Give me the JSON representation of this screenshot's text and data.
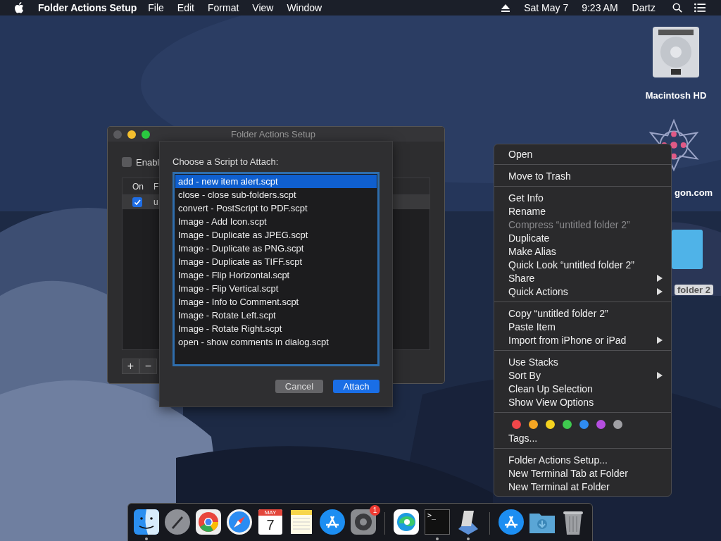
{
  "menubar": {
    "app_name": "Folder Actions Setup",
    "menus": [
      "File",
      "Edit",
      "Format",
      "View",
      "Window"
    ],
    "date": "Sat May 7",
    "time": "9:23 AM",
    "user": "Dartz"
  },
  "desktop_icons": [
    {
      "label": "Macintosh HD",
      "kind": "disk"
    },
    {
      "label": "gon.com",
      "kind": "star"
    },
    {
      "label": "folder 2",
      "kind": "folder"
    }
  ],
  "window": {
    "title": "Folder Actions Setup",
    "enable": {
      "label": "Enabl",
      "checked": false
    },
    "columns": [
      "On",
      "F"
    ],
    "rows": [
      {
        "on": true,
        "text": "u"
      }
    ],
    "add_label": "+",
    "remove_label": "−"
  },
  "sheet": {
    "prompt": "Choose a Script to Attach:",
    "scripts": [
      {
        "label": "add - new item alert.scpt",
        "selected": true
      },
      {
        "label": "close - close sub-folders.scpt",
        "selected": false
      },
      {
        "label": "convert - PostScript to PDF.scpt",
        "selected": false
      },
      {
        "label": "Image - Add Icon.scpt",
        "selected": false
      },
      {
        "label": "Image - Duplicate as JPEG.scpt",
        "selected": false
      },
      {
        "label": "Image - Duplicate as PNG.scpt",
        "selected": false
      },
      {
        "label": "Image - Duplicate as TIFF.scpt",
        "selected": false
      },
      {
        "label": "Image - Flip Horizontal.scpt",
        "selected": false
      },
      {
        "label": "Image - Flip Vertical.scpt",
        "selected": false
      },
      {
        "label": "Image - Info to Comment.scpt",
        "selected": false
      },
      {
        "label": "Image - Rotate Left.scpt",
        "selected": false
      },
      {
        "label": "Image - Rotate Right.scpt",
        "selected": false
      },
      {
        "label": "open - show comments in dialog.scpt",
        "selected": false
      }
    ],
    "cancel": "Cancel",
    "attach": "Attach"
  },
  "context_menu": [
    {
      "items": [
        {
          "label": "Open",
          "kind": "item",
          "disabled": false
        }
      ]
    },
    {
      "items": [
        {
          "label": "Move to Trash",
          "kind": "item",
          "disabled": false
        }
      ]
    },
    {
      "items": [
        {
          "label": "Get Info",
          "kind": "item",
          "disabled": false
        },
        {
          "label": "Rename",
          "kind": "item",
          "disabled": false
        },
        {
          "label": "Compress “untitled folder 2”",
          "kind": "item",
          "disabled": true
        },
        {
          "label": "Duplicate",
          "kind": "item",
          "disabled": false
        },
        {
          "label": "Make Alias",
          "kind": "item",
          "disabled": false
        },
        {
          "label": "Quick Look “untitled folder 2”",
          "kind": "item",
          "disabled": false
        },
        {
          "label": "Share",
          "kind": "submenu",
          "disabled": false
        },
        {
          "label": "Quick Actions",
          "kind": "submenu",
          "disabled": false
        }
      ]
    },
    {
      "items": [
        {
          "label": "Copy “untitled folder 2”",
          "kind": "item",
          "disabled": false
        },
        {
          "label": "Paste Item",
          "kind": "item",
          "disabled": false
        },
        {
          "label": "Import from iPhone or iPad",
          "kind": "submenu",
          "disabled": false
        }
      ]
    },
    {
      "items": [
        {
          "label": "Use Stacks",
          "kind": "item",
          "disabled": false
        },
        {
          "label": "Sort By",
          "kind": "submenu",
          "disabled": false
        },
        {
          "label": "Clean Up Selection",
          "kind": "item",
          "disabled": false
        },
        {
          "label": "Show View Options",
          "kind": "item",
          "disabled": false
        }
      ]
    },
    {
      "tags": [
        {
          "color": "#f0474a"
        },
        {
          "color": "#f5a623"
        },
        {
          "color": "#f4d21f"
        },
        {
          "color": "#3fc94f"
        },
        {
          "color": "#2f8cf0"
        },
        {
          "color": "#b54ee0"
        },
        {
          "color": "#a0a0a5"
        }
      ],
      "items": [
        {
          "label": "Tags...",
          "kind": "item",
          "disabled": false
        }
      ]
    },
    {
      "items": [
        {
          "label": "Folder Actions Setup...",
          "kind": "item",
          "disabled": false
        },
        {
          "label": "New Terminal Tab at Folder",
          "kind": "item",
          "disabled": false
        },
        {
          "label": "New Terminal at Folder",
          "kind": "item",
          "disabled": false
        }
      ]
    }
  ],
  "dock": [
    {
      "kind": "finder",
      "running": true
    },
    {
      "kind": "launchpad",
      "running": false
    },
    {
      "kind": "chrome",
      "running": false
    },
    {
      "kind": "safari",
      "running": false
    },
    {
      "kind": "calendar",
      "running": false,
      "month": "MAY",
      "day": "7"
    },
    {
      "kind": "notes",
      "running": false
    },
    {
      "kind": "appstore",
      "running": false
    },
    {
      "kind": "settings",
      "running": false,
      "badge": "1"
    },
    {
      "kind": "separator"
    },
    {
      "kind": "edge",
      "running": false
    },
    {
      "kind": "terminal",
      "running": true,
      "prompt": ">_"
    },
    {
      "kind": "script",
      "running": true
    },
    {
      "kind": "separator"
    },
    {
      "kind": "appstore",
      "running": false
    },
    {
      "kind": "downloads",
      "running": false
    },
    {
      "kind": "trash",
      "running": false
    }
  ]
}
